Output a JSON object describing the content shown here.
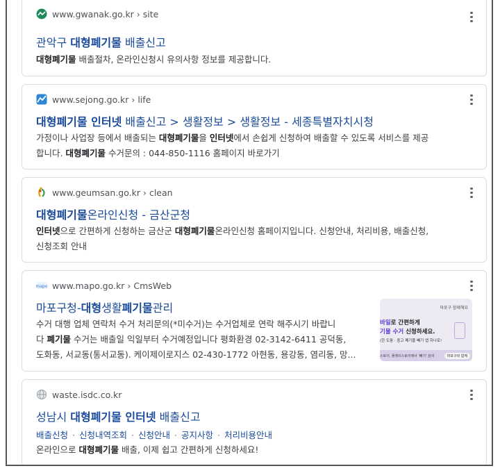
{
  "results": [
    {
      "domain": "www.gwanak.go.kr",
      "path": " › site",
      "title_pre": "관악구 ",
      "title_bold": "대형폐기물",
      "title_post": " 배출신고",
      "snippet": [
        {
          "b": "대형폐기물"
        },
        {
          "t": " 배출절차, 온라인신청시 유의사항 정보를 제공합니다."
        }
      ]
    },
    {
      "domain": "www.sejong.go.kr",
      "path": " › life",
      "title_bold": "대형폐기물 인터넷",
      "title_post": " 배출신고 > 생활정보 > 생활정보 - 세종특별자치시청",
      "snippet_line1": [
        {
          "t": "가정이나 사업장 등에서 배출되는 "
        },
        {
          "b": "대형폐기물"
        },
        {
          "t": "을 "
        },
        {
          "b": "인터넷"
        },
        {
          "t": "에서 손쉽게 신청하여 배출할 수 있도록 서비스를 제공"
        }
      ],
      "snippet_line2": [
        {
          "t": "합니다. "
        },
        {
          "b": "대형폐기물"
        },
        {
          "t": " 수거문의 : 044-850-1116 홈페이지 바로가기"
        }
      ]
    },
    {
      "domain": "www.geumsan.go.kr",
      "path": " › clean",
      "title_bold": "대형폐기물",
      "title_post": "온라인신청 - 금산군청",
      "snippet_line1": [
        {
          "b": "인터넷"
        },
        {
          "t": "으로 간편하게 신청하는 금산군 "
        },
        {
          "b": "대형폐기물"
        },
        {
          "t": "온라인신청 홈페이지입니다. 신청안내, 처리비용, 배출신청,"
        }
      ],
      "snippet_line2": [
        {
          "t": "신청조회 안내"
        }
      ]
    },
    {
      "domain": "www.mapo.go.kr",
      "path": " › CmsWeb",
      "title_pre": "마포구청-",
      "title_bold": "대형",
      "title_mid": "생활",
      "title_bold2": "폐기물",
      "title_post": "관리",
      "snippet_line1": [
        {
          "t": "수거 대행 업체 연락처 수거 처리문의(*미수거)는 수거업체로 연락 해주시기 바랍니"
        }
      ],
      "snippet_line2": [
        {
          "t": "다 "
        },
        {
          "b": "폐기물"
        },
        {
          "t": " 수거는 배출일 익일부터 수거예정입니다 평화환경 02-3142-6411 공덕동,"
        }
      ],
      "snippet_line3": [
        {
          "t": "도화동, 서교동(통서교동). 케이제이로지스 02-430-1772 아현동, 용강동, 염리동, 망..."
        }
      ],
      "thumb": {
        "header": "마포구 함께해요",
        "line1_pre": "바일",
        "line1_post": "로 간편하게",
        "line2_pre": "기물 수거",
        "line2_post": " 신청하세요.",
        "line3": "(한 도움 · 중고 폐기물 빼기 앱 하나로!",
        "footer": "스토어, 플레이스토어에서 '빼기' 검색",
        "badge": "마포구와 함께"
      }
    },
    {
      "domain": "waste.isdc.co.kr",
      "path": "",
      "title_pre": "성남시 ",
      "title_bold": "대형폐기물 인터넷",
      "title_post": " 배출신고",
      "sitelinks": [
        "배출신청",
        "신청내역조회",
        "신청안내",
        "공지사항",
        "처리비용안내"
      ],
      "snippet": [
        {
          "t": "온라인으로 "
        },
        {
          "b": "대형폐기물"
        },
        {
          "t": " 배출, 이제 쉽고 간편하게 신청하세요!"
        }
      ]
    }
  ],
  "colors": {
    "link": "#1a4a9a",
    "url": "#4d5156",
    "snippet": "#3c4043",
    "border": "#dadce0"
  },
  "icons": {
    "more": "more-vert-icon",
    "gwanak": "gwanak-favicon-icon",
    "sejong": "sejong-favicon-icon",
    "geumsan": "geumsan-favicon-icon",
    "mapo": "mapo-favicon-icon",
    "isdc": "globe-favicon-icon"
  }
}
